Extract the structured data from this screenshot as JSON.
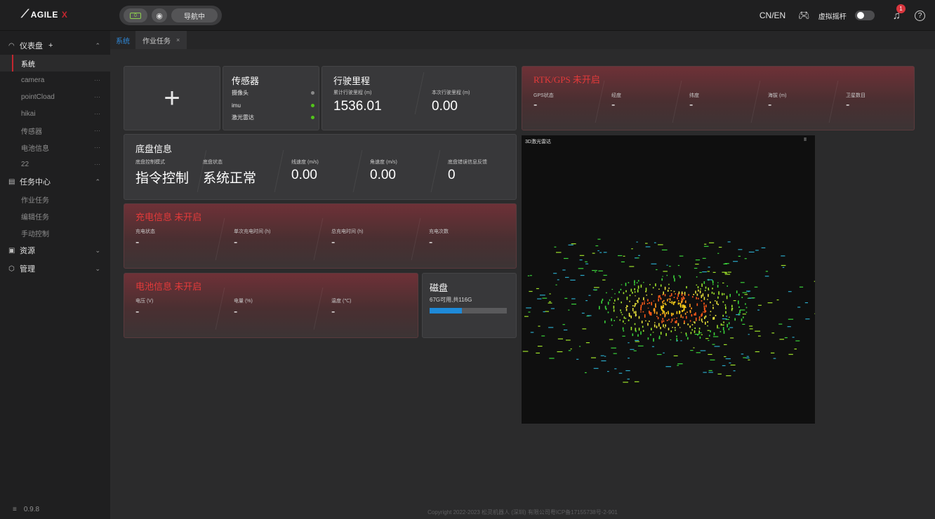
{
  "app": {
    "logo_text": "AGILE",
    "logo_suffix": "X",
    "version": "0.9.8"
  },
  "topbar": {
    "battery_level": "0",
    "nav_status": "导航中",
    "lang": "CN/EN",
    "virtual_joystick": "虚拟摇杆",
    "notifications": "1",
    "help": "?"
  },
  "sidebar": {
    "dashboard": {
      "label": "仪表盘",
      "add": "+"
    },
    "dashboard_items": [
      {
        "label": "系统"
      },
      {
        "label": "camera"
      },
      {
        "label": "pointCload"
      },
      {
        "label": "hikai"
      },
      {
        "label": "传感器"
      },
      {
        "label": "电池信息"
      },
      {
        "label": "22"
      }
    ],
    "task_center": {
      "label": "任务中心"
    },
    "task_items": [
      {
        "label": "作业任务"
      },
      {
        "label": "编辑任务"
      },
      {
        "label": "手动控制"
      }
    ],
    "resources": {
      "label": "资源"
    },
    "manage": {
      "label": "管理"
    },
    "more": "···"
  },
  "tabs": [
    {
      "label": "系统"
    },
    {
      "label": "作业任务",
      "close": "×"
    }
  ],
  "sensors": {
    "title": "传感器",
    "items": [
      {
        "label": "摄像头",
        "color": "#8a8a8a"
      },
      {
        "label": "imu",
        "color": "#52c41a"
      },
      {
        "label": "激光雷达",
        "color": "#52c41a"
      }
    ]
  },
  "mileage": {
    "title": "行驶里程",
    "total_label": "累计行驶里程 (m)",
    "total_value": "1536.01",
    "current_label": "本次行驶里程 (m)",
    "current_value": "0.00"
  },
  "rtk": {
    "title": "RTK/GPS 未开启",
    "fields": [
      {
        "label": "GPS状态",
        "value": "-"
      },
      {
        "label": "经度",
        "value": "-"
      },
      {
        "label": "纬度",
        "value": "-"
      },
      {
        "label": "海拔 (m)",
        "value": "-"
      },
      {
        "label": "卫星数目",
        "value": "-"
      }
    ]
  },
  "chassis": {
    "title": "底盘信息",
    "fields": [
      {
        "label": "底盘控制模式",
        "value": "指令控制"
      },
      {
        "label": "底盘状态",
        "value": "系统正常"
      },
      {
        "label": "线速度 (m/s)",
        "value": "0.00"
      },
      {
        "label": "角速度 (m/s)",
        "value": "0.00"
      },
      {
        "label": "底盘错误信息反馈",
        "value": "0"
      }
    ]
  },
  "charging": {
    "title": "充电信息 未开启",
    "fields": [
      {
        "label": "充电状态",
        "value": "-"
      },
      {
        "label": "单次充电时间 (h)",
        "value": "-"
      },
      {
        "label": "总充电时间 (h)",
        "value": "-"
      },
      {
        "label": "充电次数",
        "value": "-"
      }
    ]
  },
  "battery": {
    "title": "电池信息 未开启",
    "fields": [
      {
        "label": "电压 (V)",
        "value": "-"
      },
      {
        "label": "电量 (%)",
        "value": "-"
      },
      {
        "label": "温度 (℃)",
        "value": "-"
      }
    ]
  },
  "disk": {
    "title": "磁盘",
    "summary": "67G可用,共116G",
    "used_fraction": 0.42,
    "color": "#1e8ad8"
  },
  "lidar": {
    "title": "3D激光雷达",
    "pause": "II"
  },
  "footer": {
    "copyright": "Copyright 2022-2023 松灵机器人 (深圳) 有限公司粤ICP备17155738号-2-901"
  }
}
